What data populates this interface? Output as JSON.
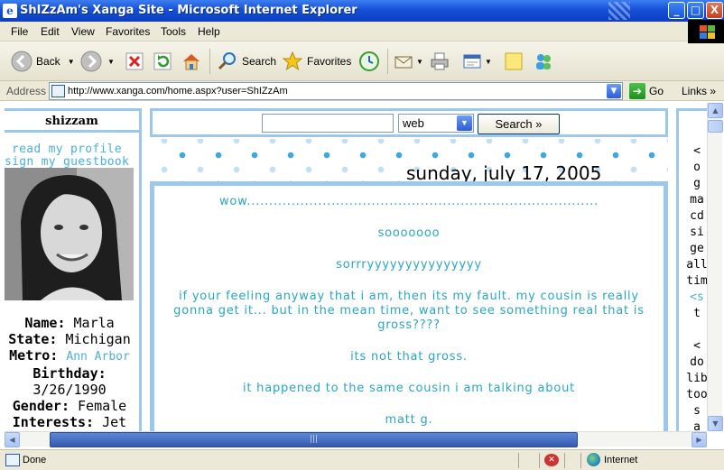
{
  "window": {
    "title": "ShIZzAm's Xanga Site - Microsoft Internet Explorer",
    "minimize": "_",
    "maximize": "□",
    "close": "X"
  },
  "menu": [
    "File",
    "Edit",
    "View",
    "Favorites",
    "Tools",
    "Help"
  ],
  "toolbar": {
    "back": "Back",
    "search": "Search",
    "favorites": "Favorites"
  },
  "address": {
    "label": "Address",
    "url": "http://www.xanga.com/home.aspx?user=ShIZzAm",
    "go": "Go",
    "links": "Links"
  },
  "sidebar": {
    "username": "shizzam",
    "read_profile": "read my profile",
    "sign_guestbook": "sign my guestbook",
    "profile": {
      "name_label": "Name:",
      "name": "Marla",
      "state_label": "State:",
      "state": "Michigan",
      "metro_label": "Metro:",
      "metro": "Ann Arbor",
      "birthday_label": "Birthday:",
      "birthday": "3/26/1990",
      "gender_label": "Gender:",
      "gender": "Female",
      "interests_label": "Interests:",
      "interests": "Jet"
    }
  },
  "search": {
    "query": "",
    "engine": "web",
    "button": "Search »"
  },
  "entry": {
    "date": "sunday, july 17, 2005",
    "paragraphs": [
      "wow...............................................................................",
      "sooooooo",
      "sorrryyyyyyyyyyyyyyy",
      "if your feeling anyway that i am, then its my fault. my cousin is really gonna get it... but in the mean time, want to see something real that is gross????",
      "its not that gross.",
      "it happened to the same cousin i am talking about",
      "matt g."
    ]
  },
  "right_column": {
    "lines": [
      "<",
      "o",
      "g",
      "ma",
      "cd",
      "si",
      "ge",
      "all",
      "tim",
      "<s",
      "t",
      "",
      "<",
      "do",
      "lib",
      "too",
      "s",
      "a"
    ]
  },
  "statusbar": {
    "status": "Done",
    "zone": "Internet"
  },
  "colors": {
    "accent_blue": "#9cc8ee",
    "link_teal": "#4ab0d8",
    "post_text": "#2aa6c4",
    "titlebar": "#1550d8"
  }
}
